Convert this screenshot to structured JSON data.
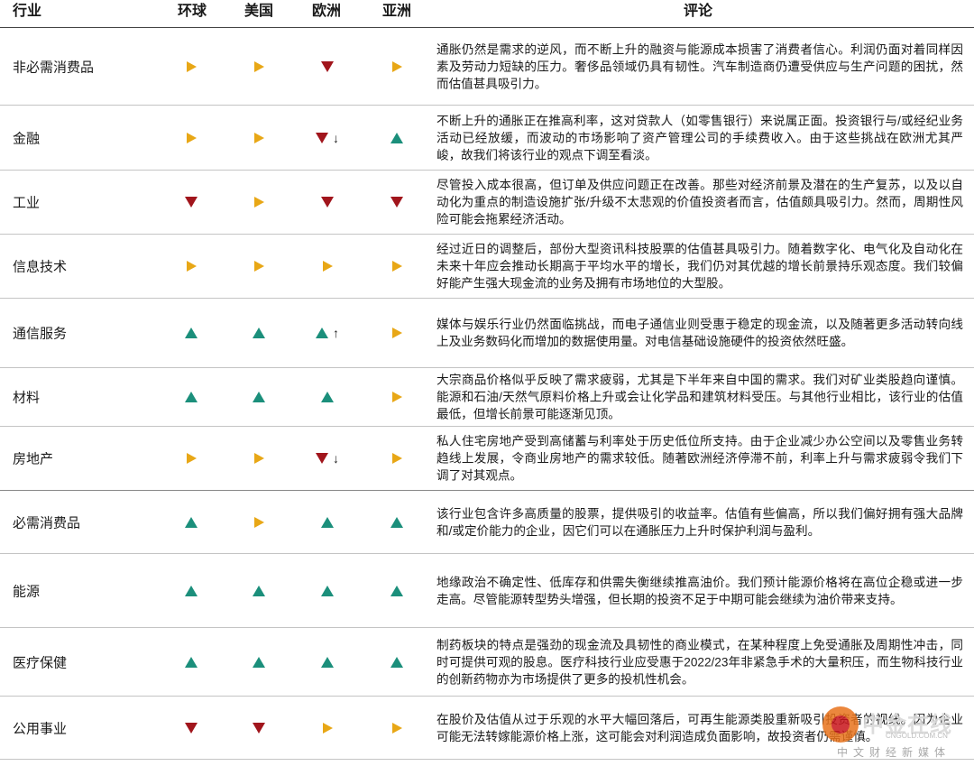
{
  "header": {
    "sector": "行业",
    "global": "环球",
    "us": "美国",
    "europe": "欧洲",
    "asia": "亚洲",
    "comment": "评论"
  },
  "legend_colors": {
    "neutral": "#e8a716",
    "positive": "#1b8f7b",
    "negative": "#a1151c"
  },
  "rows": [
    {
      "sector": "非必需消费品",
      "global": "neutral",
      "us": "neutral",
      "europe": "negative",
      "asia": "neutral",
      "comment": "通胀仍然是需求的逆风，而不断上升的融资与能源成本损害了消费者信心。利润仍面对着同样因素及劳动力短缺的压力。奢侈品领域仍具有韧性。汽车制造商仍遭受供应与生产问题的困扰，然而估值甚具吸引力。"
    },
    {
      "sector": "金融",
      "global": "neutral",
      "us": "neutral",
      "europe": "negative",
      "europe_change": "↓",
      "asia": "positive",
      "comment": "不断上升的通胀正在推高利率，这对贷款人（如零售银行）来说属正面。投资银行与/或经纪业务活动已经放缓，而波动的市场影响了资产管理公司的手续费收入。由于这些挑战在欧洲尤其严峻，故我们将该行业的观点下调至看淡。"
    },
    {
      "sector": "工业",
      "global": "negative",
      "us": "neutral",
      "europe": "negative",
      "asia": "negative",
      "comment": "尽管投入成本很高，但订单及供应问题正在改善。那些对经济前景及潜在的生产复苏，以及以自动化为重点的制造设施扩张/升级不太悲观的价值投资者而言，估值颇具吸引力。然而，周期性风险可能会拖累经济活动。"
    },
    {
      "sector": "信息技术",
      "global": "neutral",
      "us": "neutral",
      "europe": "neutral",
      "asia": "neutral",
      "comment": "经过近日的调整后，部份大型资讯科技股票的估值甚具吸引力。随着数字化、电气化及自动化在未来十年应会推动长期高于平均水平的增长，我们仍对其优越的增长前景持乐观态度。我们较偏好能产生强大现金流的业务及拥有市场地位的大型股。"
    },
    {
      "sector": "通信服务",
      "global": "positive",
      "us": "positive",
      "europe": "positive",
      "europe_change": "↑",
      "asia": "neutral",
      "comment": "媒体与娱乐行业仍然面临挑战，而电子通信业则受惠于稳定的现金流，以及随著更多活动转向线上及业务数码化而增加的数据使用量。对电信基础设施硬件的投资依然旺盛。"
    },
    {
      "sector": "材料",
      "global": "positive",
      "us": "positive",
      "europe": "positive",
      "asia": "neutral",
      "comment": "大宗商品价格似乎反映了需求疲弱，尤其是下半年来自中国的需求。我们对矿业类股趋向谨慎。能源和石油/天然气原料价格上升或会让化学品和建筑材料受压。与其他行业相比，该行业的估值最低，但增长前景可能逐渐见顶。"
    },
    {
      "sector": "房地产",
      "global": "neutral",
      "us": "neutral",
      "europe": "negative",
      "europe_change": "↓",
      "asia": "neutral",
      "comment": "私人住宅房地产受到高储蓄与利率处于历史低位所支持。由于企业减少办公空间以及零售业务转趋线上发展，令商业房地产的需求较低。随著欧洲经济停滞不前，利率上升与需求疲弱令我们下调了对其观点。"
    },
    {
      "sector": "必需消费品",
      "global": "positive",
      "us": "neutral",
      "europe": "positive",
      "asia": "positive",
      "comment": "该行业包含许多高质量的股票，提供吸引的收益率。估值有些偏高，所以我们偏好拥有强大品牌和/或定价能力的企业，因它们可以在通胀压力上升时保护利润与盈利。"
    },
    {
      "sector": "能源",
      "global": "positive",
      "us": "positive",
      "europe": "positive",
      "asia": "positive",
      "comment": "地缘政治不确定性、低库存和供需失衡继续推高油价。我们预计能源价格将在高位企稳或进一步走高。尽管能源转型势头增强，但长期的投资不足于中期可能会继续为油价带来支持。"
    },
    {
      "sector": "医疗保健",
      "global": "positive",
      "us": "positive",
      "europe": "positive",
      "asia": "positive",
      "comment": "制药板块的特点是强劲的现金流及具韧性的商业模式，在某种程度上免受通胀及周期性冲击，同时可提供可观的股息。医疗科技行业应受惠于2022/23年非紧急手术的大量积压，而生物科技行业的创新药物亦为市场提供了更多的投机性机会。"
    },
    {
      "sector": "公用事业",
      "global": "negative",
      "us": "negative",
      "europe": "neutral",
      "asia": "neutral",
      "comment": "在股价及估值从过于乐观的水平大幅回落后，可再生能源类股重新吸引投资者的视线。因为企业可能无法转嫁能源价格上涨，这可能会对利润造成负面影响，故投资者仍需谨慎。"
    }
  ],
  "watermark": {
    "brand": "中金在线",
    "url": "CNGOLD.COM.CN",
    "tagline": "中文财经新媒体"
  }
}
